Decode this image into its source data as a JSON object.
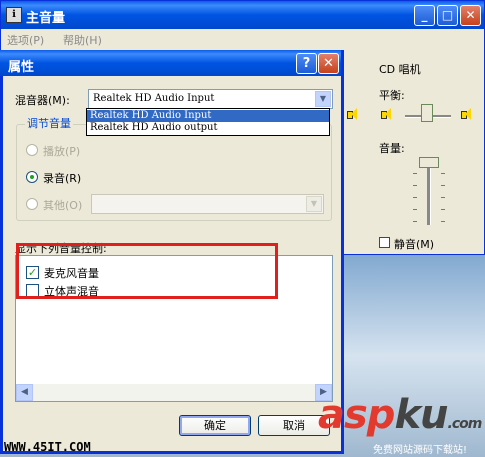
{
  "main_window": {
    "title": "主音量",
    "menu": [
      "选项(P)",
      "帮助(H)"
    ],
    "column_title": "CD 唱机",
    "balance_label": "平衡:",
    "volume_label": "音量:",
    "mute_label": "静音(M)"
  },
  "dialog": {
    "title": "属性",
    "help_glyph": "?",
    "close_glyph": "✕",
    "mixer_label": "混音器(M):",
    "mixer_value": "Realtek HD Audio Input",
    "mixer_options": [
      "Realtek HD Audio Input",
      "Realtek HD Audio output"
    ],
    "adjust_group_label": "调节音量",
    "radio_playback": "播放(P)",
    "radio_record": "录音(R)",
    "radio_other": "其他(O)",
    "controls_label": "显示下列音量控制:",
    "controls": [
      {
        "label": "麦克风音量",
        "checked": true
      },
      {
        "label": "立体声混音",
        "checked": false
      }
    ],
    "ok_label": "确定",
    "cancel_label": "取消"
  },
  "watermark": {
    "url": "WWW.45IT.COM",
    "logo_a": "asp",
    "logo_b": "ku",
    "logo_c": ".com",
    "logo_sub": "免费网站源码下载站!"
  },
  "colors": {
    "titlebar": "#0054e3",
    "highlight": "#316ac5",
    "annotation": "#e0201c",
    "dialog_bg": "#ece9d8"
  }
}
